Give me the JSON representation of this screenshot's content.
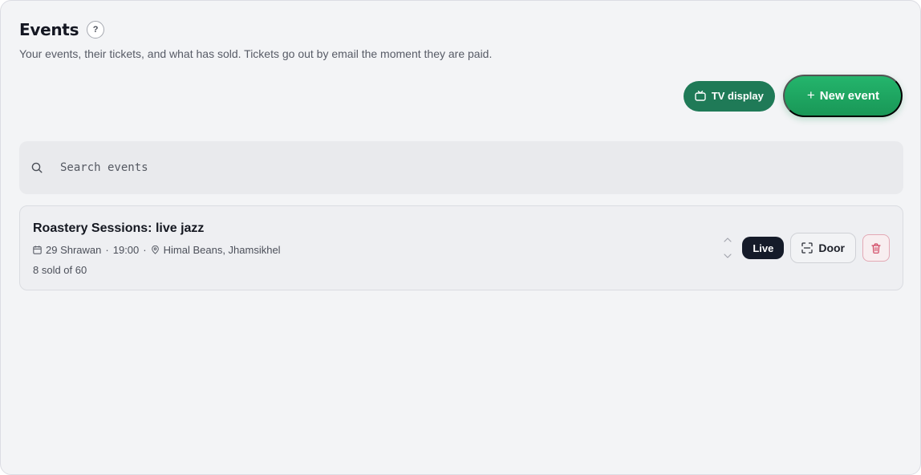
{
  "header": {
    "title": "Events",
    "help_label": "?",
    "subtitle": "Your events, their tickets, and what has sold. Tickets go out by email the moment they are paid."
  },
  "actions": {
    "tv_display_label": "TV display",
    "new_event_plus": "+",
    "new_event_label": "New event"
  },
  "search": {
    "placeholder": "Search events",
    "icon": "search-icon"
  },
  "events": [
    {
      "title": "Roastery Sessions: live jazz",
      "date": "29 Shrawan",
      "time": "19:00",
      "venue": "Himal Beans, Jhamsikhel",
      "sold_text": "8 sold of 60",
      "status": "Live",
      "door_label": "Door"
    }
  ],
  "separators": {
    "dot": "·"
  },
  "colors": {
    "accent_green": "#199757",
    "tv_button": "#1f7a57",
    "live_badge": "#151b29",
    "delete_red": "#d0435f"
  }
}
